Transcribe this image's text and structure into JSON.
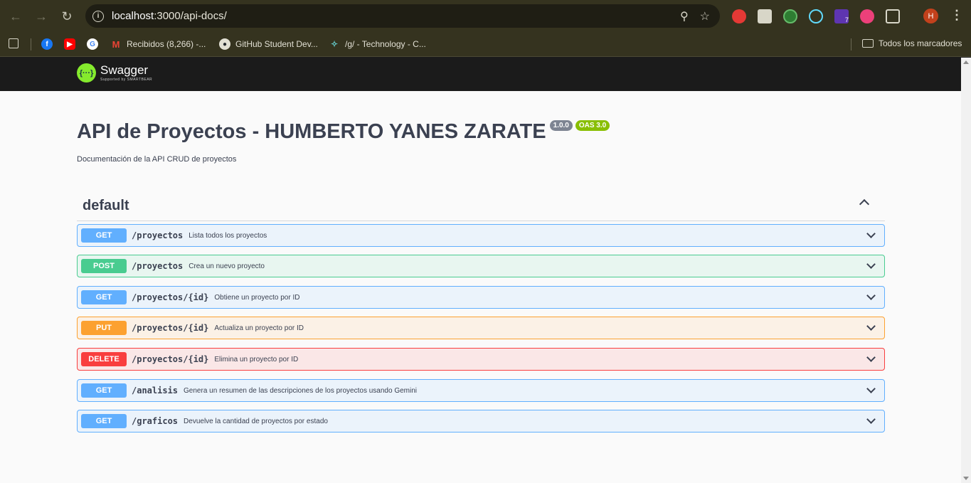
{
  "browser": {
    "url_host": "localhost",
    "url_rest": ":3000/api-docs/",
    "profile_initial": "H",
    "bookmarks": [
      {
        "label": "",
        "icon": "facebook-icon"
      },
      {
        "label": "",
        "icon": "youtube-icon"
      },
      {
        "label": "",
        "icon": "google-icon"
      },
      {
        "label": "Recibidos (8,266) -...",
        "icon": "gmail-icon"
      },
      {
        "label": "GitHub Student Dev...",
        "icon": "github-icon"
      },
      {
        "label": "/g/ - Technology - C...",
        "icon": "4chan-icon"
      }
    ],
    "all_bookmarks_label": "Todos los marcadores",
    "extension_badge": "7"
  },
  "swagger": {
    "brand": "Swagger",
    "brand_sub": "Supported by SMARTBEAR",
    "logo_glyph": "{···}"
  },
  "api": {
    "title": "API de Proyectos - HUMBERTO YANES ZARATE",
    "version": "1.0.0",
    "oas": "OAS 3.0",
    "description": "Documentación de la API CRUD de proyectos"
  },
  "section": {
    "name": "default"
  },
  "operations": [
    {
      "method": "GET",
      "path": "/proyectos",
      "summary": "Lista todos los proyectos"
    },
    {
      "method": "POST",
      "path": "/proyectos",
      "summary": "Crea un nuevo proyecto"
    },
    {
      "method": "GET",
      "path": "/proyectos/{id}",
      "summary": "Obtiene un proyecto por ID"
    },
    {
      "method": "PUT",
      "path": "/proyectos/{id}",
      "summary": "Actualiza un proyecto por ID"
    },
    {
      "method": "DELETE",
      "path": "/proyectos/{id}",
      "summary": "Elimina un proyecto por ID"
    },
    {
      "method": "GET",
      "path": "/analisis",
      "summary": "Genera un resumen de las descripciones de los proyectos usando Gemini"
    },
    {
      "method": "GET",
      "path": "/graficos",
      "summary": "Devuelve la cantidad de proyectos por estado"
    }
  ],
  "colors": {
    "get": "#61affe",
    "post": "#49cc90",
    "put": "#fca130",
    "delete": "#f93e3e",
    "swagger_green": "#85ea2d"
  }
}
